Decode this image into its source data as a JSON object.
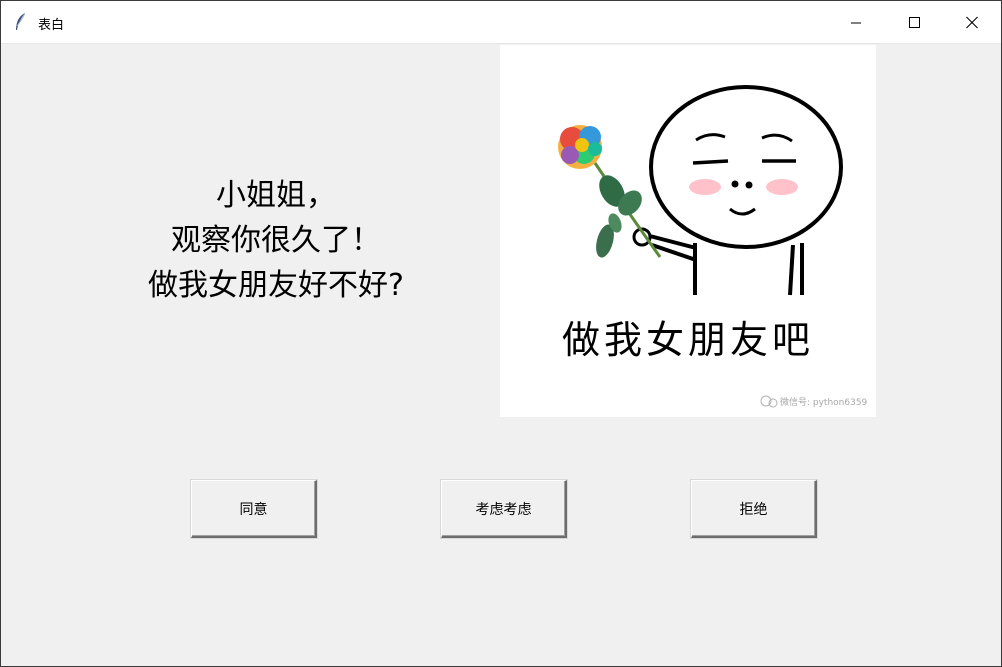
{
  "window": {
    "title": "表白"
  },
  "message": {
    "lines": [
      "小姐姐，",
      "观察你很久了！",
      "做我女朋友好不好?"
    ]
  },
  "meme": {
    "caption": "做我女朋友吧",
    "watermark": "微信号: python6359"
  },
  "buttons": {
    "agree": "同意",
    "consider": "考虑考虑",
    "reject": "拒绝"
  },
  "icons": {
    "app": "feather-icon",
    "minimize": "minimize-icon",
    "maximize": "maximize-icon",
    "close": "close-icon"
  },
  "colors": {
    "window_bg": "#f0f0f0",
    "titlebar_bg": "#ffffff",
    "image_bg": "#ffffff",
    "blush": "#ffb6c1"
  }
}
